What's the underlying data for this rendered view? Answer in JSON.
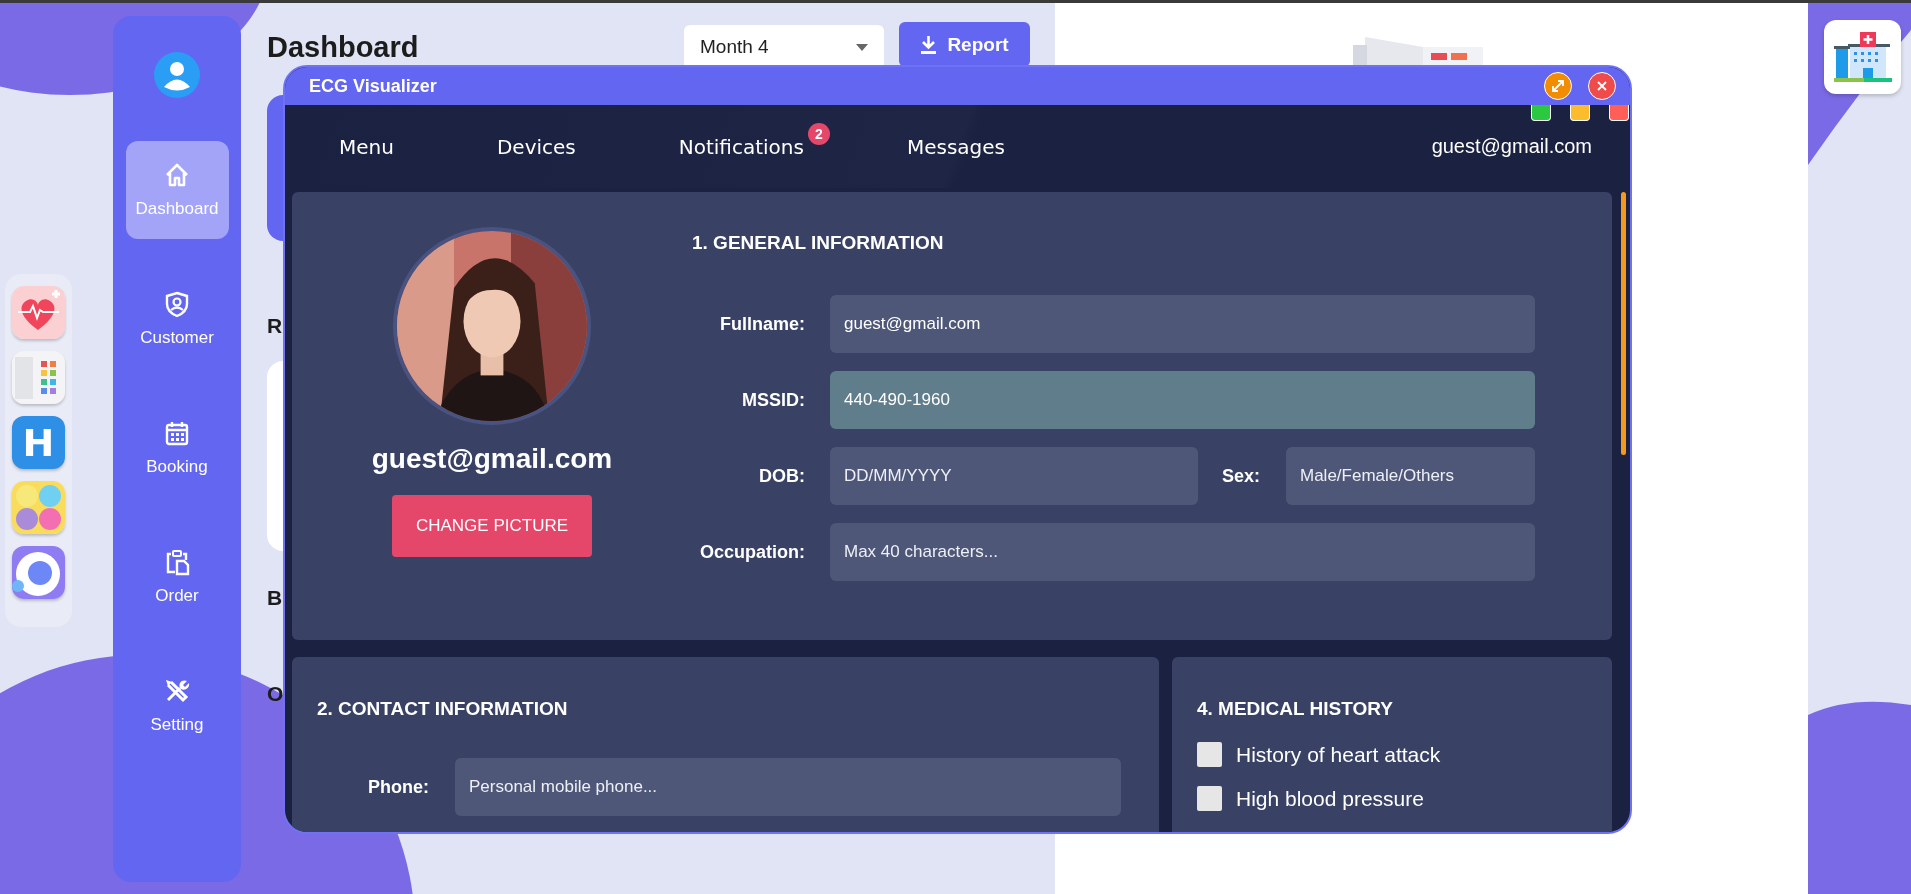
{
  "dock": {
    "apps": [
      {
        "kind": "heart"
      },
      {
        "kind": "grid"
      },
      {
        "kind": "letter",
        "label": "H"
      },
      {
        "kind": "faces"
      },
      {
        "kind": "ring"
      }
    ]
  },
  "sidebar": {
    "items": [
      {
        "label": "Dashboard",
        "selected": true
      },
      {
        "label": "Customer",
        "selected": false
      },
      {
        "label": "Booking",
        "selected": false
      },
      {
        "label": "Order",
        "selected": false
      },
      {
        "label": "Setting",
        "selected": false
      }
    ]
  },
  "dashboard": {
    "title": "Dashboard",
    "period_select": {
      "value": "Month 4"
    },
    "report_button": {
      "label": "Report"
    },
    "section_headings": [
      "R",
      "B",
      "O"
    ]
  },
  "window": {
    "title": "ECG Visualizer",
    "nav": {
      "items": [
        {
          "label": "Menu"
        },
        {
          "label": "Devices"
        },
        {
          "label": "Notifications",
          "badge": "2"
        },
        {
          "label": "Messages"
        }
      ],
      "user": "guest@gmail.com"
    },
    "profile": {
      "name": "guest@gmail.com",
      "change_button": "CHANGE PICTURE"
    },
    "general": {
      "heading": "1. GENERAL INFORMATION",
      "rows": [
        {
          "fields": [
            {
              "label": "Fullname:",
              "value": "guest@gmail.com",
              "readonly": false
            }
          ]
        },
        {
          "fields": [
            {
              "label": "MSSID:",
              "value": "440-490-1960",
              "readonly": true
            }
          ]
        },
        {
          "fields": [
            {
              "label": "DOB:",
              "placeholder": "DD/MM/YYYY",
              "readonly": false
            },
            {
              "label": "Sex:",
              "placeholder": "Male/Female/Others",
              "readonly": false
            }
          ]
        },
        {
          "fields": [
            {
              "label": "Occupation:",
              "placeholder": "Max 40 characters...",
              "readonly": false
            }
          ]
        }
      ]
    },
    "contact": {
      "heading": "2. CONTACT INFORMATION",
      "rows": [
        {
          "fields": [
            {
              "label": "Phone:",
              "placeholder": "Personal mobile phone...",
              "readonly": false
            }
          ]
        }
      ]
    },
    "medical": {
      "heading": "4. MEDICAL HISTORY",
      "items": [
        {
          "label": "History of heart attack",
          "checked": false
        },
        {
          "label": "High blood pressure",
          "checked": false
        }
      ]
    }
  },
  "corner_app": {
    "kind": "hospital"
  }
}
